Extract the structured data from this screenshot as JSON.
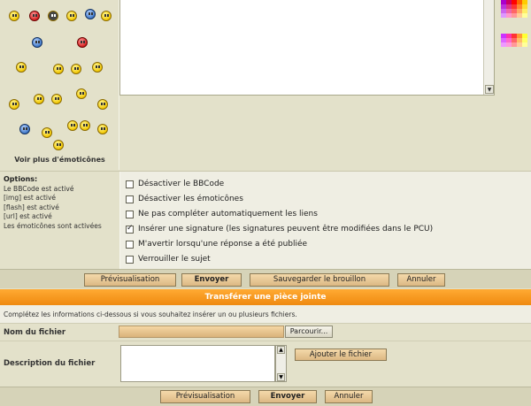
{
  "emoticons": {
    "more_link": "Voir plus d'émoticônes"
  },
  "options": {
    "title": "Options:",
    "status": [
      "Le BBCode est activé",
      "[img] est activé",
      "[flash] est activé",
      "[url] est activé",
      "Les émoticônes sont activées"
    ],
    "checkboxes": [
      {
        "label": "Désactiver le BBCode",
        "checked": false
      },
      {
        "label": "Désactiver les émoticônes",
        "checked": false
      },
      {
        "label": "Ne pas compléter automatiquement les liens",
        "checked": false
      },
      {
        "label": "Insérer une signature (les signatures peuvent être modifiées dans le PCU)",
        "checked": true
      },
      {
        "label": "M'avertir lorsqu'une réponse a été publiée",
        "checked": false
      },
      {
        "label": "Verrouiller le sujet",
        "checked": false
      }
    ]
  },
  "buttons": {
    "preview": "Prévisualisation",
    "submit": "Envoyer",
    "save_draft": "Sauvegarder le brouillon",
    "cancel": "Annuler"
  },
  "attachment": {
    "header": "Transférer une pièce jointe",
    "description": "Complétez les informations ci-dessous si vous souhaitez insérer un ou plusieurs fichiers.",
    "file_label": "Nom du fichier",
    "browse": "Parcourir...",
    "file_desc_label": "Description du fichier",
    "add_file": "Ajouter le fichier"
  },
  "bottom_buttons": {
    "preview": "Prévisualisation",
    "submit": "Envoyer",
    "cancel": "Annuler"
  },
  "colors": {
    "panel": "#e3e1ca",
    "accent_orange": "#ef8a10",
    "button": "#dcb883"
  }
}
